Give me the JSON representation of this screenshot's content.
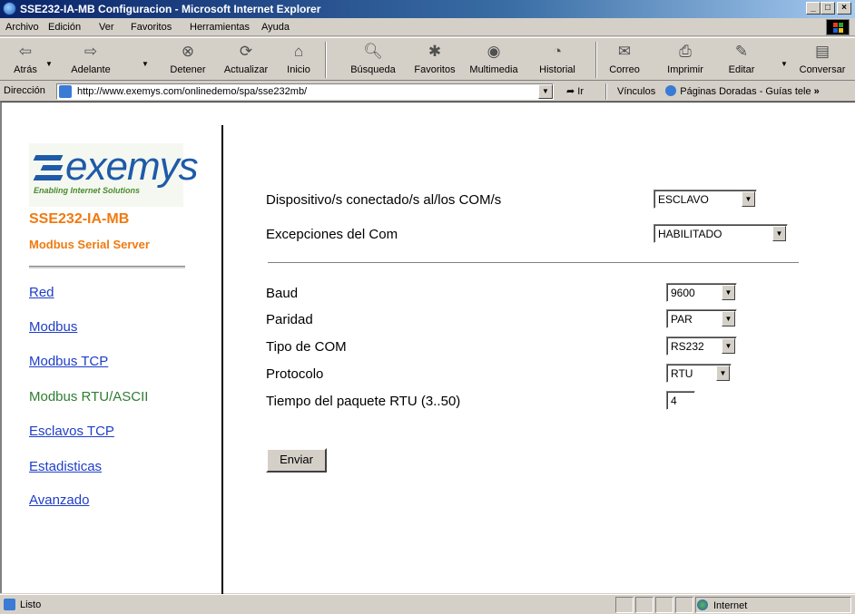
{
  "window": {
    "title": "SSE232-IA-MB Configuracion - Microsoft Internet Explorer",
    "controls": [
      "_",
      "□",
      "×"
    ]
  },
  "menu": [
    "Archivo",
    "Edición",
    "Ver",
    "Favoritos",
    "Herramientas",
    "Ayuda"
  ],
  "toolbar": {
    "back": "Atrás",
    "forward": "Adelante",
    "stop": "Detener",
    "refresh": "Actualizar",
    "home": "Inicio",
    "search": "Búsqueda",
    "favorites": "Favoritos",
    "multimedia": "Multimedia",
    "history": "Historial",
    "mail": "Correo",
    "print": "Imprimir",
    "edit": "Editar",
    "discuss": "Conversar"
  },
  "address": {
    "label": "Dirección",
    "url": "http://www.exemys.com/onlinedemo/spa/sse232mb/",
    "go": "Ir",
    "links_label": "Vínculos",
    "links_item": "Páginas Doradas - Guías tele",
    "chevron": "»"
  },
  "sidebar": {
    "logo_word": "exemys",
    "logo_tagline": "Enabling Internet Solutions",
    "product_name": "SSE232-IA-MB",
    "product_subtitle": "Modbus Serial Server",
    "links": [
      {
        "label": "Red"
      },
      {
        "label": "Modbus"
      },
      {
        "label": "Modbus TCP"
      },
      {
        "label": "Modbus RTU/ASCII"
      },
      {
        "label": "Esclavos TCP"
      },
      {
        "label": "Estadisticas"
      },
      {
        "label": "Avanzado"
      }
    ]
  },
  "form": {
    "device_label": "Dispositivo/s conectado/s al/los COM/s",
    "device_value": "ESCLAVO",
    "exceptions_label": "Excepciones del Com",
    "exceptions_value": "HABILITADO",
    "baud_label": "Baud",
    "baud_value": "9600",
    "parity_label": "Paridad",
    "parity_value": "PAR",
    "com_type_label": "Tipo de COM",
    "com_type_value": "RS232",
    "protocol_label": "Protocolo",
    "protocol_value": "RTU",
    "rtu_time_label": "Tiempo del paquete RTU (3..50)",
    "rtu_time_value": "4",
    "submit_label": "Enviar"
  },
  "status": {
    "text": "Listo",
    "zone": "Internet"
  }
}
